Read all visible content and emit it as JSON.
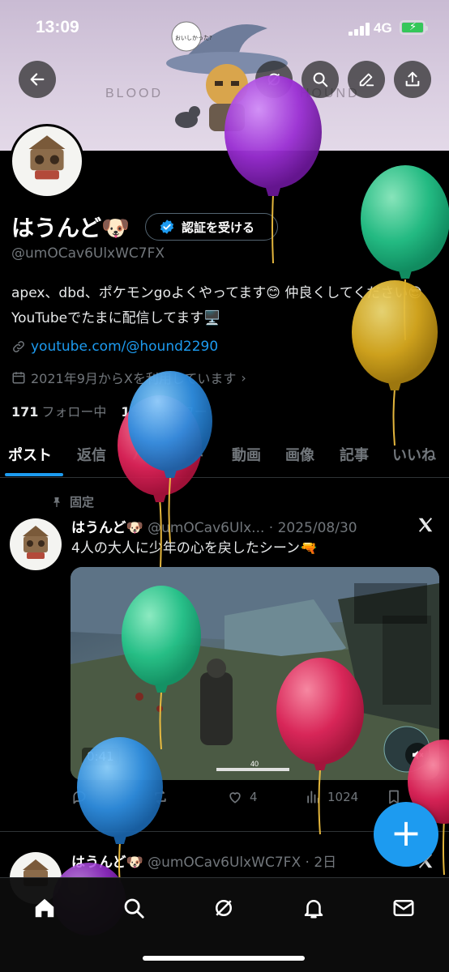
{
  "status_bar": {
    "time": "13:09",
    "network": "4G"
  },
  "profile": {
    "display_name": "はうんど🐶",
    "verify_label": "認証を受ける",
    "handle": "@umOCav6UlxWC7FX",
    "bio": "apex、dbd、ポケモンgoよくやってます😊 仲良くしてください😎 YouTubeでたまに配信してます🖥️",
    "link": "youtube.com/@hound2290",
    "joined": "2021年9月からXを利用しています",
    "following_count": "171",
    "following_label": "フォロー中",
    "followers_count": "16",
    "followers_label": "フォロワー"
  },
  "banner": {
    "text_left": "BLOOD",
    "text_right": "HOUND",
    "bubble": "おいしかった?"
  },
  "tabs": [
    "ポスト",
    "返信",
    "ハイライト",
    "動画",
    "画像",
    "記事",
    "いいね"
  ],
  "pinned_tweet": {
    "pinned_label": "固定",
    "name": "はうんど🐶",
    "handle_date": "@umOCav6Ulx... · 2025/08/30",
    "text": "4人の大人に少年の心を戻したシーン🔫",
    "video_time": "0:41",
    "hud_value": "40",
    "likes": "4",
    "views": "1024"
  },
  "second_tweet": {
    "name": "はうんど🐶",
    "handle_date": "@umOCav6UlxWC7FX · 2日"
  },
  "icons": {
    "back": "arrow-left-icon",
    "grok": "grok-icon",
    "search": "search-icon",
    "edit": "edit-icon",
    "share": "share-icon",
    "home": "home-icon",
    "notifications": "bell-icon",
    "messages": "mail-icon",
    "compose": "plus-icon"
  },
  "colors": {
    "accent": "#1d9bf0",
    "banner": "#d9cde0",
    "background": "#000000"
  }
}
